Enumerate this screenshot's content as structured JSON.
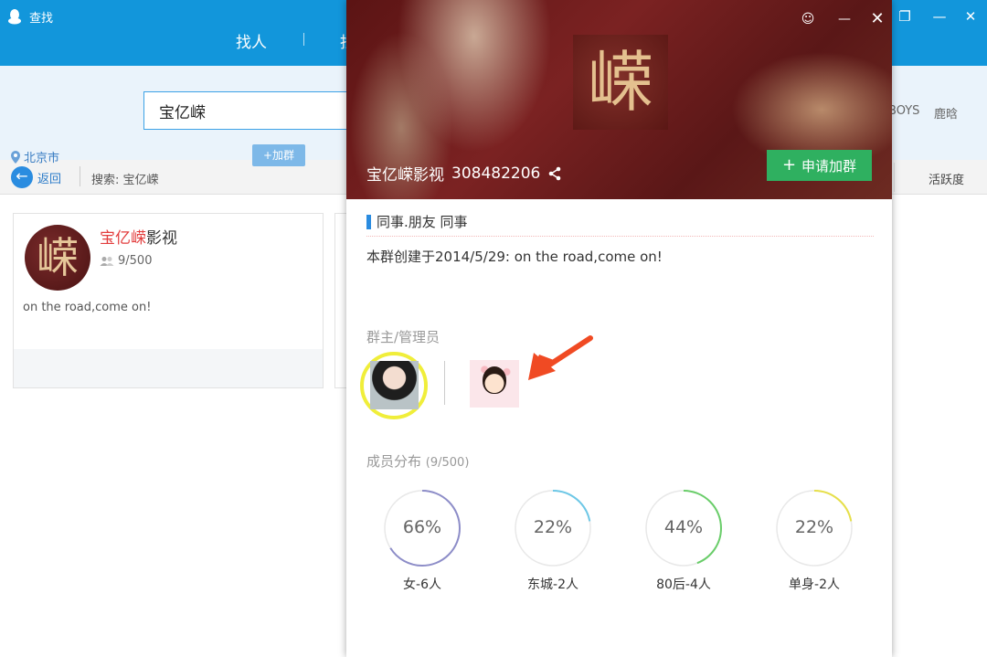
{
  "background_window": {
    "title": "查找",
    "tabs": [
      "找人",
      "找"
    ],
    "search_value": "宝亿嵘",
    "hot_keywords": [
      "BOYS",
      "鹿晗"
    ],
    "back_label": "返回",
    "search_crumb": "搜索: 宝亿嵘",
    "sort_label": "活跃度",
    "result": {
      "avatar_char": "嵘",
      "name_highlight": "宝亿嵘",
      "name_rest": "影视",
      "members": "9/500",
      "description": "on the road,come on!",
      "location": "北京市",
      "join_label": "+加群"
    }
  },
  "popup": {
    "logo_char": "嵘",
    "group_name": "宝亿嵘影视",
    "group_id": "308482206",
    "apply_label": "申请加群",
    "tags": "同事.朋友  同事",
    "created_text": "本群创建于2014/5/29:  on the road,come on!",
    "admin_label": "群主/管理员",
    "members_label": "成员分布",
    "members_count": "(9/500)",
    "stats": [
      {
        "percent": 66,
        "label": "女-6人",
        "color": "#8d8dc8"
      },
      {
        "percent": 22,
        "label": "东城-2人",
        "color": "#6dc7e6"
      },
      {
        "percent": 44,
        "label": "80后-4人",
        "color": "#6acd6a"
      },
      {
        "percent": 22,
        "label": "单身-2人",
        "color": "#e6df4a"
      }
    ]
  },
  "colors": {
    "brand_blue": "#1296db",
    "apply_green": "#2fb060",
    "highlight_red": "#e23c3c",
    "owner_ring": "#f0ee3a",
    "arrow": "#f04a23"
  }
}
